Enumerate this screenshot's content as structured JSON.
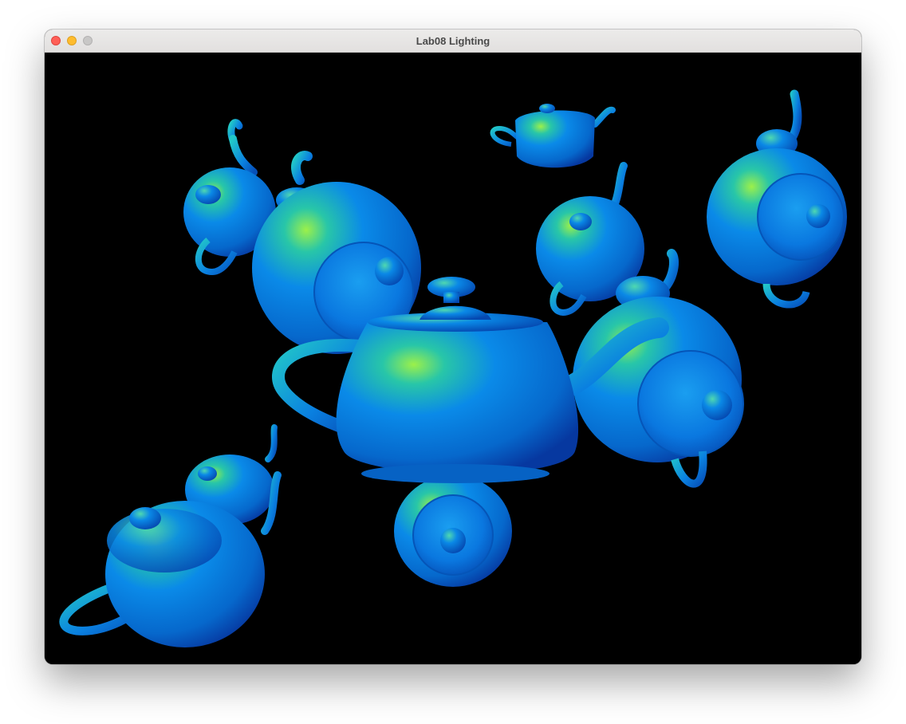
{
  "window": {
    "title": "Lab08 Lighting"
  },
  "scene": {
    "background": "#000000",
    "object": "teapot",
    "teapot_count": 11,
    "colors": {
      "base": "#0a7fe6",
      "highlight": "#9cf04a",
      "rim": "#00c0d8",
      "shadow": "#0638a0"
    }
  }
}
